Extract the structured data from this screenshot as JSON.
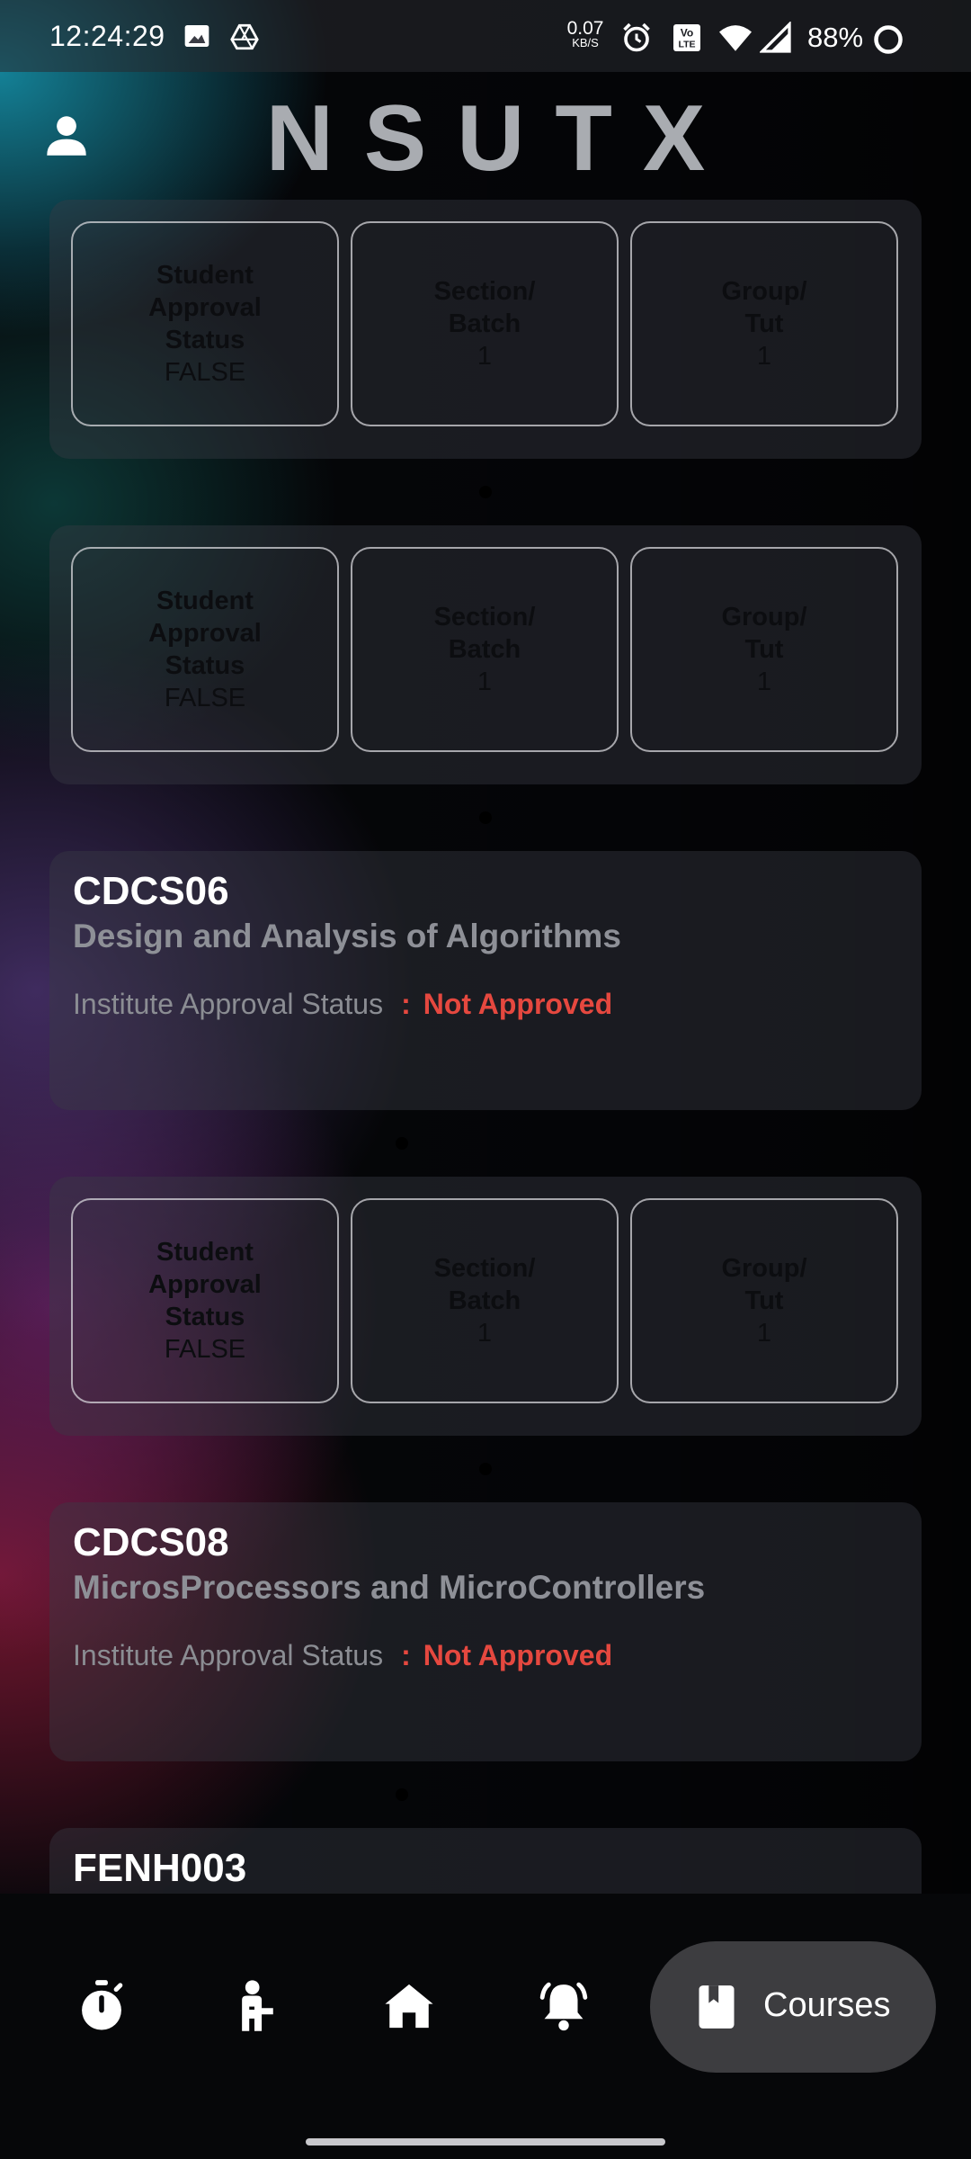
{
  "status_bar": {
    "time": "12:24:29",
    "speed_value": "0.07",
    "speed_unit": "KB/S",
    "battery": "88%",
    "icons": [
      "image-icon",
      "drive-icon",
      "alarm-icon",
      "volte-icon",
      "wifi-icon",
      "signal-icon",
      "battery-ring-icon"
    ]
  },
  "header": {
    "title": "NSUTX",
    "profile_icon": "person-icon"
  },
  "labels": {
    "student_approval": "Student\nApproval\nStatus",
    "section_batch": "Section/\nBatch",
    "group_tut": "Group/\nTut",
    "institute_approval": "Institute Approval Status",
    "separator": ":"
  },
  "info_cards": [
    {
      "student_approval_value": "FALSE",
      "section_value": "1",
      "group_value": "1"
    },
    {
      "student_approval_value": "FALSE",
      "section_value": "1",
      "group_value": "1"
    },
    {
      "student_approval_value": "FALSE",
      "section_value": "1",
      "group_value": "1"
    }
  ],
  "courses": [
    {
      "code": "CDCS06",
      "name": "Design and Analysis of Algorithms",
      "approval": "Not Approved"
    },
    {
      "code": "CDCS08",
      "name": "MicrosProcessors and MicroControllers",
      "approval": "Not Approved"
    },
    {
      "code": "FENH003"
    }
  ],
  "bottom_nav": {
    "items": [
      {
        "icon": "stopwatch-icon"
      },
      {
        "icon": "person-raising-hand-icon"
      },
      {
        "icon": "home-icon"
      },
      {
        "icon": "bell-ringing-icon"
      }
    ],
    "active": {
      "icon": "book-icon",
      "label": "Courses"
    }
  },
  "colors": {
    "not_approved": "#e5483f",
    "accent_pill": "#3d3d40"
  }
}
